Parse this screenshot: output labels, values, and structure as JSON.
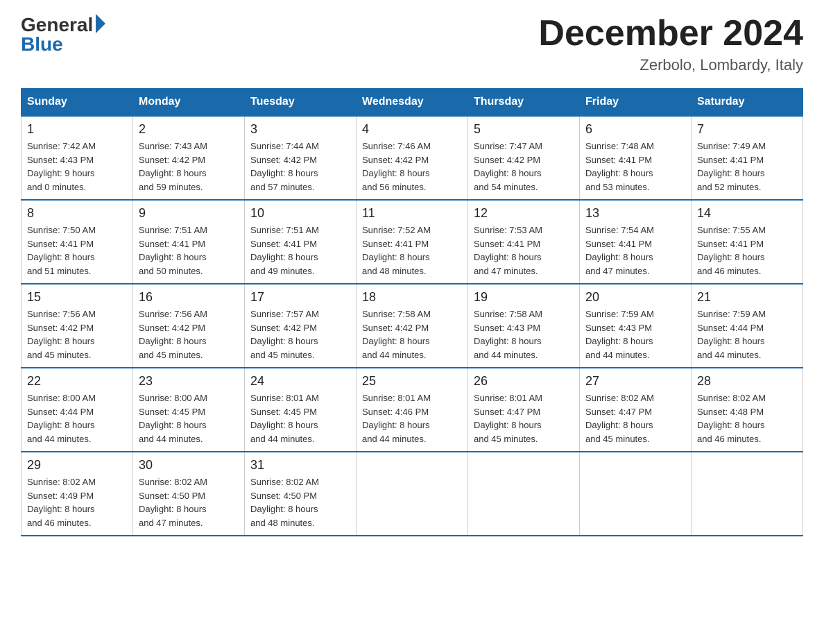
{
  "logo": {
    "general": "General",
    "blue": "Blue"
  },
  "header": {
    "title": "December 2024",
    "subtitle": "Zerbolo, Lombardy, Italy"
  },
  "days_of_week": [
    "Sunday",
    "Monday",
    "Tuesday",
    "Wednesday",
    "Thursday",
    "Friday",
    "Saturday"
  ],
  "weeks": [
    [
      {
        "day": "1",
        "info": "Sunrise: 7:42 AM\nSunset: 4:43 PM\nDaylight: 9 hours\nand 0 minutes."
      },
      {
        "day": "2",
        "info": "Sunrise: 7:43 AM\nSunset: 4:42 PM\nDaylight: 8 hours\nand 59 minutes."
      },
      {
        "day": "3",
        "info": "Sunrise: 7:44 AM\nSunset: 4:42 PM\nDaylight: 8 hours\nand 57 minutes."
      },
      {
        "day": "4",
        "info": "Sunrise: 7:46 AM\nSunset: 4:42 PM\nDaylight: 8 hours\nand 56 minutes."
      },
      {
        "day": "5",
        "info": "Sunrise: 7:47 AM\nSunset: 4:42 PM\nDaylight: 8 hours\nand 54 minutes."
      },
      {
        "day": "6",
        "info": "Sunrise: 7:48 AM\nSunset: 4:41 PM\nDaylight: 8 hours\nand 53 minutes."
      },
      {
        "day": "7",
        "info": "Sunrise: 7:49 AM\nSunset: 4:41 PM\nDaylight: 8 hours\nand 52 minutes."
      }
    ],
    [
      {
        "day": "8",
        "info": "Sunrise: 7:50 AM\nSunset: 4:41 PM\nDaylight: 8 hours\nand 51 minutes."
      },
      {
        "day": "9",
        "info": "Sunrise: 7:51 AM\nSunset: 4:41 PM\nDaylight: 8 hours\nand 50 minutes."
      },
      {
        "day": "10",
        "info": "Sunrise: 7:51 AM\nSunset: 4:41 PM\nDaylight: 8 hours\nand 49 minutes."
      },
      {
        "day": "11",
        "info": "Sunrise: 7:52 AM\nSunset: 4:41 PM\nDaylight: 8 hours\nand 48 minutes."
      },
      {
        "day": "12",
        "info": "Sunrise: 7:53 AM\nSunset: 4:41 PM\nDaylight: 8 hours\nand 47 minutes."
      },
      {
        "day": "13",
        "info": "Sunrise: 7:54 AM\nSunset: 4:41 PM\nDaylight: 8 hours\nand 47 minutes."
      },
      {
        "day": "14",
        "info": "Sunrise: 7:55 AM\nSunset: 4:41 PM\nDaylight: 8 hours\nand 46 minutes."
      }
    ],
    [
      {
        "day": "15",
        "info": "Sunrise: 7:56 AM\nSunset: 4:42 PM\nDaylight: 8 hours\nand 45 minutes."
      },
      {
        "day": "16",
        "info": "Sunrise: 7:56 AM\nSunset: 4:42 PM\nDaylight: 8 hours\nand 45 minutes."
      },
      {
        "day": "17",
        "info": "Sunrise: 7:57 AM\nSunset: 4:42 PM\nDaylight: 8 hours\nand 45 minutes."
      },
      {
        "day": "18",
        "info": "Sunrise: 7:58 AM\nSunset: 4:42 PM\nDaylight: 8 hours\nand 44 minutes."
      },
      {
        "day": "19",
        "info": "Sunrise: 7:58 AM\nSunset: 4:43 PM\nDaylight: 8 hours\nand 44 minutes."
      },
      {
        "day": "20",
        "info": "Sunrise: 7:59 AM\nSunset: 4:43 PM\nDaylight: 8 hours\nand 44 minutes."
      },
      {
        "day": "21",
        "info": "Sunrise: 7:59 AM\nSunset: 4:44 PM\nDaylight: 8 hours\nand 44 minutes."
      }
    ],
    [
      {
        "day": "22",
        "info": "Sunrise: 8:00 AM\nSunset: 4:44 PM\nDaylight: 8 hours\nand 44 minutes."
      },
      {
        "day": "23",
        "info": "Sunrise: 8:00 AM\nSunset: 4:45 PM\nDaylight: 8 hours\nand 44 minutes."
      },
      {
        "day": "24",
        "info": "Sunrise: 8:01 AM\nSunset: 4:45 PM\nDaylight: 8 hours\nand 44 minutes."
      },
      {
        "day": "25",
        "info": "Sunrise: 8:01 AM\nSunset: 4:46 PM\nDaylight: 8 hours\nand 44 minutes."
      },
      {
        "day": "26",
        "info": "Sunrise: 8:01 AM\nSunset: 4:47 PM\nDaylight: 8 hours\nand 45 minutes."
      },
      {
        "day": "27",
        "info": "Sunrise: 8:02 AM\nSunset: 4:47 PM\nDaylight: 8 hours\nand 45 minutes."
      },
      {
        "day": "28",
        "info": "Sunrise: 8:02 AM\nSunset: 4:48 PM\nDaylight: 8 hours\nand 46 minutes."
      }
    ],
    [
      {
        "day": "29",
        "info": "Sunrise: 8:02 AM\nSunset: 4:49 PM\nDaylight: 8 hours\nand 46 minutes."
      },
      {
        "day": "30",
        "info": "Sunrise: 8:02 AM\nSunset: 4:50 PM\nDaylight: 8 hours\nand 47 minutes."
      },
      {
        "day": "31",
        "info": "Sunrise: 8:02 AM\nSunset: 4:50 PM\nDaylight: 8 hours\nand 48 minutes."
      },
      {
        "day": "",
        "info": ""
      },
      {
        "day": "",
        "info": ""
      },
      {
        "day": "",
        "info": ""
      },
      {
        "day": "",
        "info": ""
      }
    ]
  ]
}
